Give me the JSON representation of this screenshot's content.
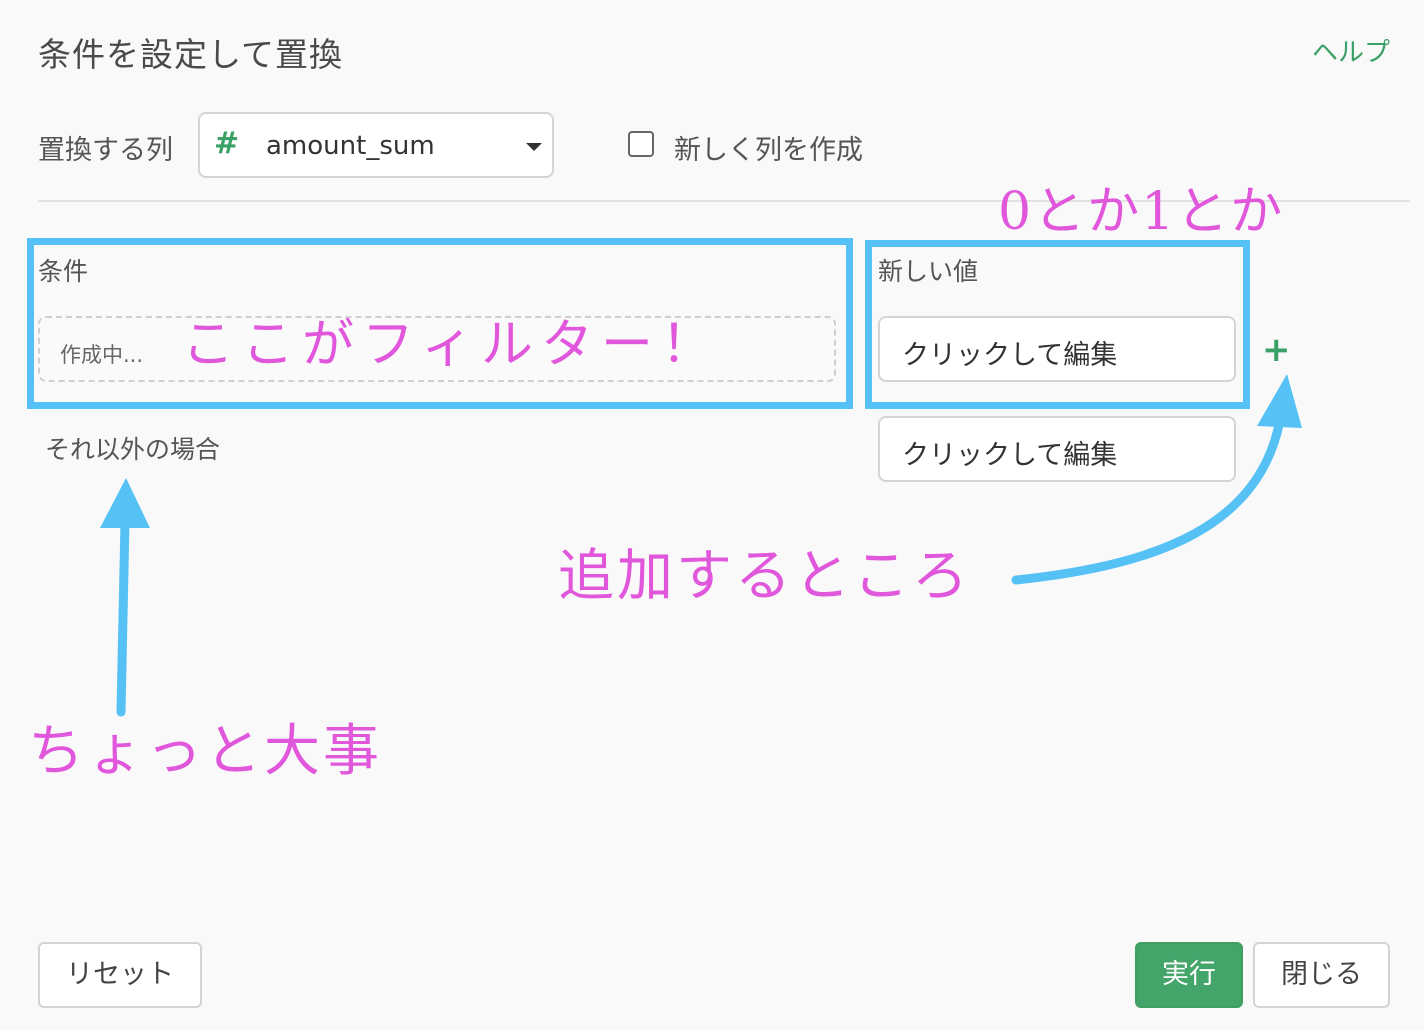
{
  "header": {
    "title": "条件を設定して置換",
    "help_link": "ヘルプ"
  },
  "column_selector": {
    "label": "置換する列",
    "type_icon": "#",
    "selected_column": "amount_sum"
  },
  "new_column_option": {
    "label": "新しく列を作成",
    "checked": false
  },
  "rules": {
    "condition_header": "条件",
    "new_value_header": "新しい値",
    "condition_placeholder": "作成中...",
    "value_placeholder": "クリックして編集",
    "otherwise_label": "それ以外の場合",
    "otherwise_value_placeholder": "クリックして編集"
  },
  "footer": {
    "reset_label": "リセット",
    "run_label": "実行",
    "close_label": "閉じる"
  },
  "annotations": {
    "filter_note": "ここがフィルター！",
    "value_note": "0とか1とか",
    "add_note": "追加するところ",
    "important_note": "ちょっと大事",
    "highlight_color": "#55c1f4",
    "text_color": "#e157dc"
  },
  "colors": {
    "accent": "#44a56b",
    "background": "#f9f9f9"
  }
}
